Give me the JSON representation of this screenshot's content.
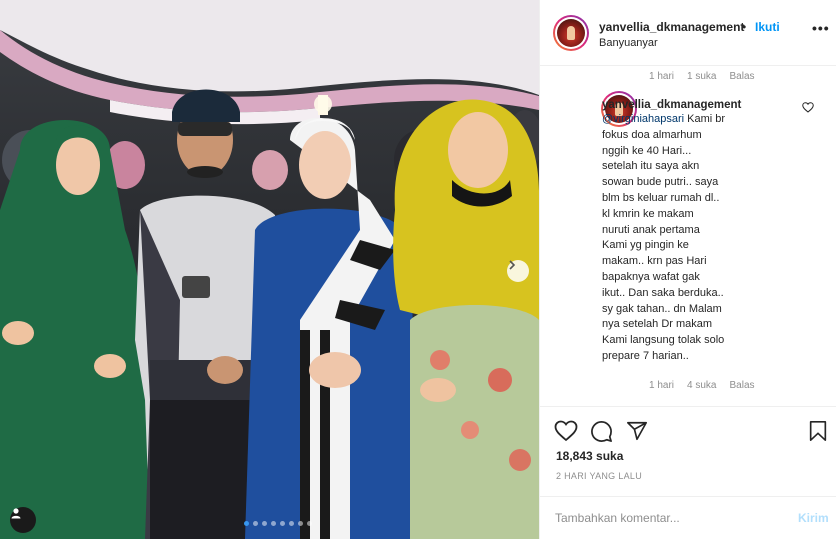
{
  "header": {
    "username": "yanvellia_dkmanagement",
    "separator": "•",
    "follow_label": "Ikuti",
    "location": "Banyuanyar",
    "more_icon": "more-horizontal-icon"
  },
  "caption_meta": {
    "age": "1 hari",
    "likes": "1 suka",
    "reply": "Balas"
  },
  "comment": {
    "username": "yanvellia_dkmanagement",
    "mention": "@virginiahapsari",
    "lines": [
      " Kami br",
      "fokus doa almarhum",
      "nggih ke 40 Hari...",
      "setelah itu saya akn",
      "sowan bude putri.. saya",
      "blm bs keluar rumah dl..",
      "kl kmrin ke makam",
      "nuruti anak pertama",
      "Kami yg pingin ke",
      "makam.. krn pas Hari",
      "bapaknya wafat gak",
      "ikut.. Dan saka berduka..",
      "sy gak tahan.. dn Malam",
      "nya setelah Dr makam",
      "Kami langsung tolak solo",
      "prepare 7 harian.."
    ],
    "age": "1 hari",
    "likes": "4 suka",
    "reply": "Balas",
    "heart_icon": "heart-outline-icon"
  },
  "actions": {
    "like_icon": "heart-icon",
    "comment_icon": "comment-icon",
    "share_icon": "send-icon",
    "save_icon": "bookmark-icon"
  },
  "likes_count": "18,843 suka",
  "time_ago": "2 HARI YANG LALU",
  "composer": {
    "placeholder": "Tambahkan komentar...",
    "send_label": "Kirim"
  },
  "carousel": {
    "total": 8,
    "active": 1
  },
  "colors": {
    "accent": "#0095f6",
    "mention": "#00376b",
    "muted": "#8e8e8e",
    "send_disabled": "#b2dffc"
  }
}
